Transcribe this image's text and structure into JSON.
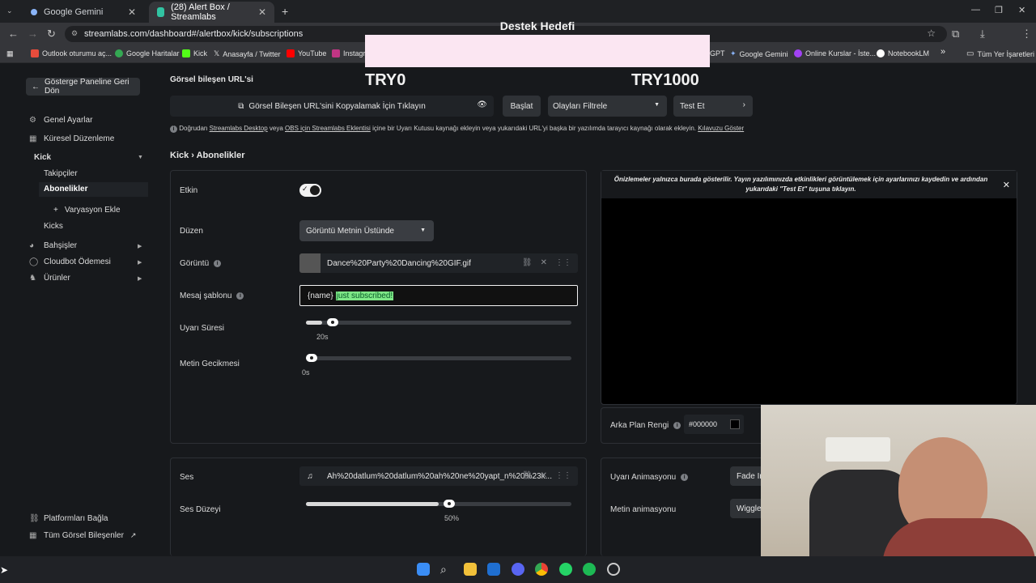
{
  "browser": {
    "tabs": [
      {
        "label": "Google Gemini",
        "active": false
      },
      {
        "label": "(28) Alert Box / Streamlabs",
        "active": true
      }
    ],
    "url": "streamlabs.com/dashboard#/alertbox/kick/subscriptions",
    "bookmarks": [
      "Outlook oturumu aç...",
      "Google Haritalar",
      "Kick",
      "Anasayfa / Twitter",
      "YouTube",
      "Instagra",
      "GPT",
      "Google Gemini",
      "Online Kurslar - İste...",
      "NotebookLM",
      "Tüm Yer İşaretleri"
    ]
  },
  "overlay": {
    "title": "Destek Hedefi",
    "min": "TRY0",
    "max": "TRY1000"
  },
  "sidebar": {
    "back": "Gösterge Paneline Geri Dön",
    "items": [
      {
        "label": "Genel Ayarlar"
      },
      {
        "label": "Küresel Düzenleme"
      },
      {
        "label": "Kick"
      }
    ],
    "sub": [
      "Takipçiler",
      "Abonelikler",
      "Varyasyon Ekle",
      "Kicks"
    ],
    "more": [
      "Bahşişler",
      "Cloudbot Ödemesi",
      "Ürünler"
    ],
    "bottom": [
      "Platformları Bağla",
      "Tüm Görsel Bileşenler"
    ]
  },
  "header": {
    "url_label": "Görsel bileşen URL'si",
    "copy_url": "Görsel Bileşen URL'sini Kopyalamak İçin Tıklayın",
    "start": "Başlat",
    "filter": "Olayları Filtrele",
    "test": "Test Et",
    "info_prefix": "Doğrudan",
    "info_link1": "Streamlabs Desktop",
    "info_mid1": "veya",
    "info_link2": "OBS için Streamlabs Eklentisi",
    "info_mid2": "içine bir Uyarı Kutusu kaynağı ekleyin veya yukarıdaki URL'yi başka bir yazılımda tarayıcı kaynağı olarak ekleyin.",
    "info_link3": "Kılavuzu Göster",
    "breadcrumb": "Kick › Abonelikler"
  },
  "form": {
    "enabled_label": "Etkin",
    "layout_label": "Düzen",
    "layout_value": "Görüntü Metnin Üstünde",
    "image_label": "Görüntü",
    "image_file": "Dance%20Party%20Dancing%20GIF.gif",
    "message_label": "Mesaj şablonu",
    "message_name": "{name}",
    "message_text": "just subscribed!",
    "duration_label": "Uyarı Süresi",
    "duration_value": "20s",
    "duration_frac": 0.06,
    "delay_label": "Metin Gecikmesi",
    "delay_value": "0s",
    "delay_frac": 0.0,
    "sound_label": "Ses",
    "sound_file": "Ah%20datlum%20datlum%20ah%20ne%20yapt_n%20%23k...",
    "volume_label": "Ses Düzeyi",
    "volume_value": "50%",
    "volume_frac": 0.5
  },
  "preview": {
    "notice": "Önizlemeler yalnızca burada gösterilir. Yayın yazılımınızda etkinlikleri görüntülemek için ayarlarınızı kaydedin ve ardından yukarıdaki \"Test Et\" tuşuna tıklayın.",
    "bg_label": "Arka Plan Rengi",
    "bg_value": "#000000",
    "anim_label": "Uyarı Animasyonu",
    "anim_value": "Fade In",
    "text_anim_label": "Metin animasyonu",
    "text_anim_value": "Wiggle"
  }
}
